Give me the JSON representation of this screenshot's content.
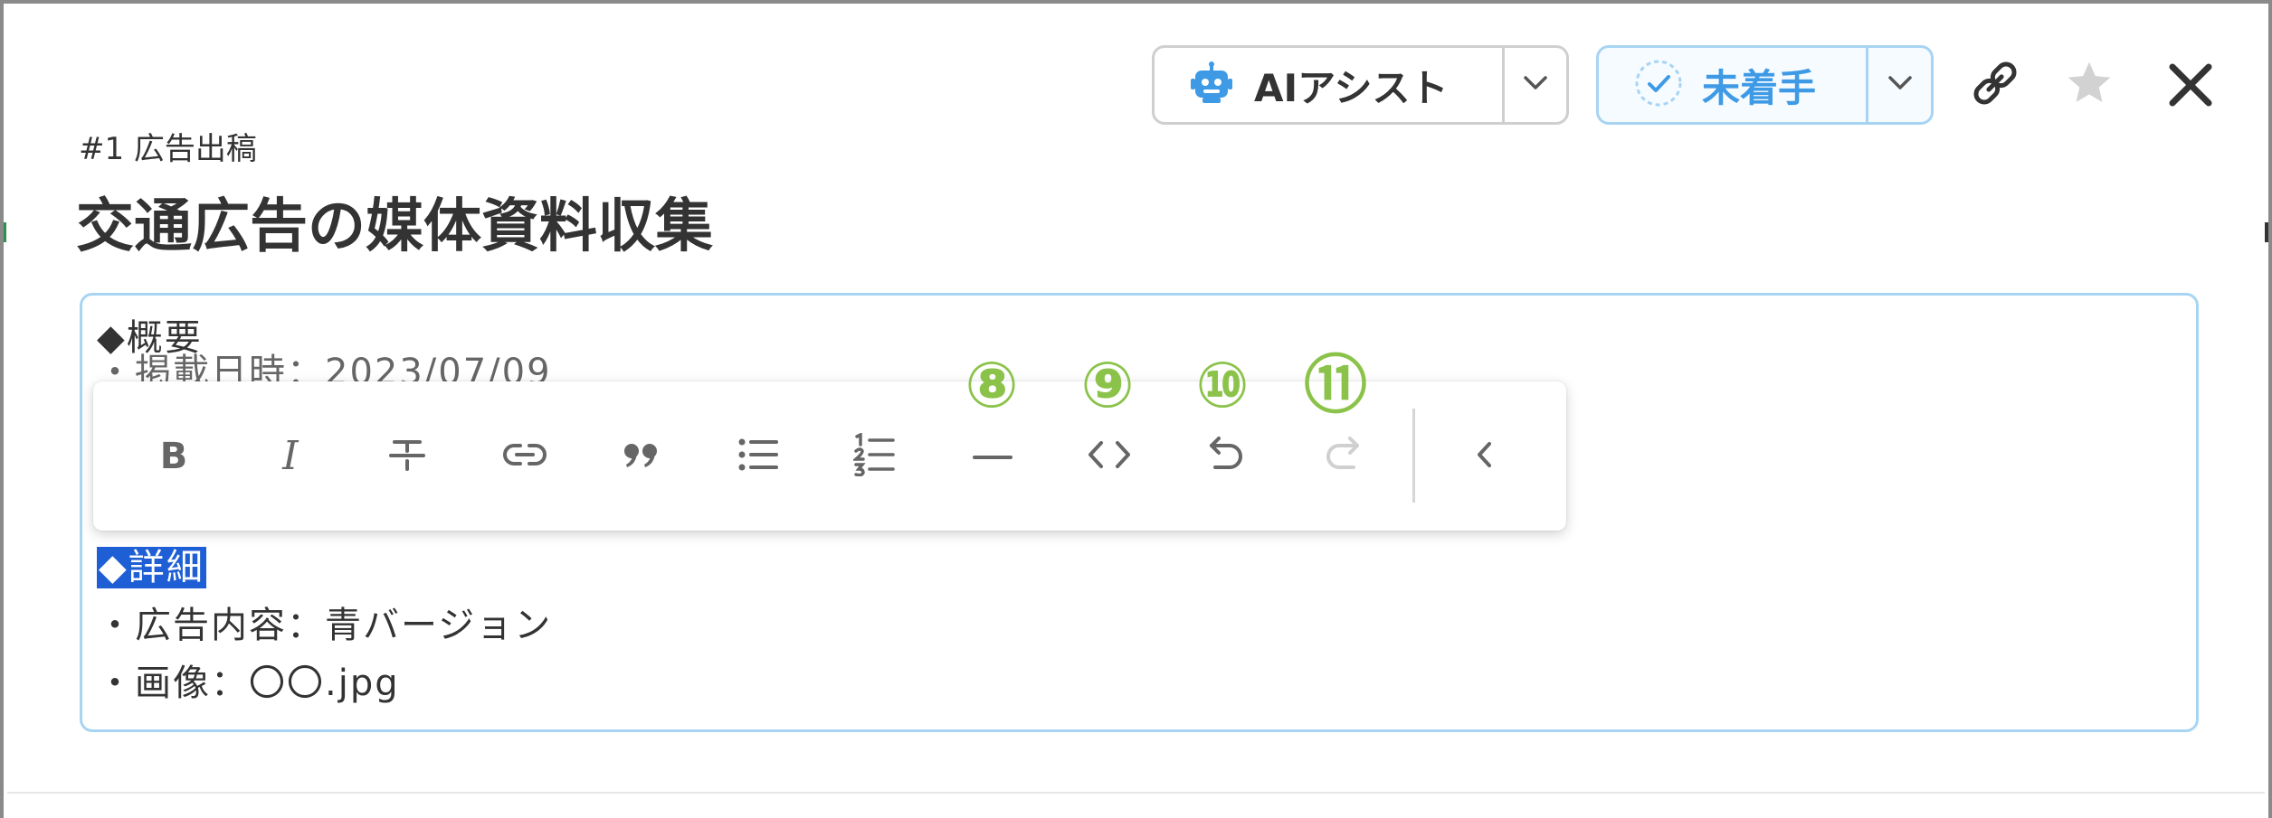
{
  "header": {
    "ai_assist_label": "AIアシスト",
    "status_label": "未着手",
    "icons": [
      "robot-icon",
      "chevron-down-icon",
      "check-circle-icon",
      "link-icon",
      "star-icon",
      "close-icon"
    ]
  },
  "task": {
    "number_label": "#1 広告出稿",
    "title": "交通広告の媒体資料収集"
  },
  "editor": {
    "lines": [
      "◆概要",
      "・掲載日時：2023/07/09",
      "◆詳細",
      "・広告内容：青バージョン",
      "・画像：〇〇.jpg"
    ],
    "selected_text": "◆詳細"
  },
  "toolbar": {
    "buttons": [
      "bold",
      "italic",
      "strikethrough",
      "link",
      "blockquote",
      "bullet-list",
      "numbered-list",
      "horizontal-rule",
      "code",
      "undo",
      "redo",
      "collapse"
    ],
    "bold_glyph": "B",
    "italic_glyph": "I"
  },
  "callouts": [
    "⑧",
    "⑨",
    "⑩",
    "⑪"
  ],
  "colors": {
    "accent_blue": "#3f9ae6",
    "border_blue": "#a8d4f3",
    "callout_green": "#8bc34a",
    "selection": "#1f5fd6"
  }
}
